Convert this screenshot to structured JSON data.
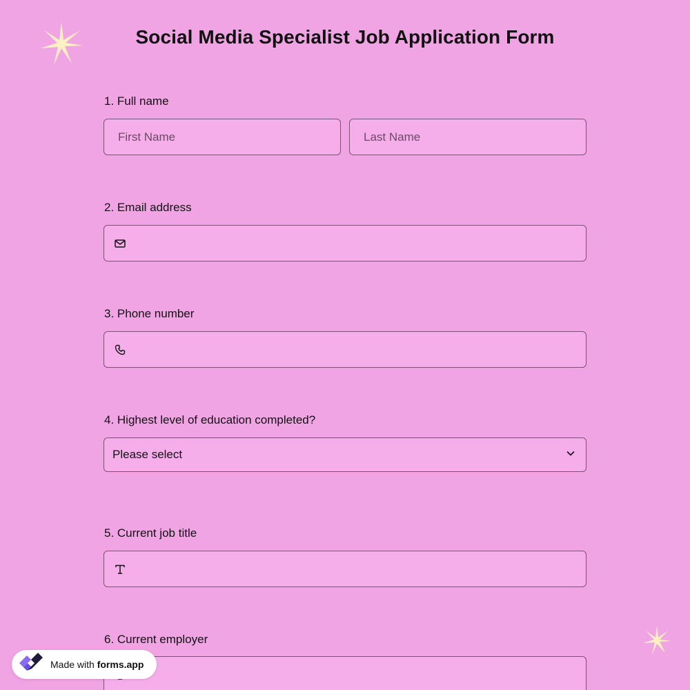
{
  "form": {
    "title": "Social Media Specialist Job Application Form"
  },
  "questions": {
    "full_name": {
      "label": "1.  Full name",
      "first_placeholder": "First Name",
      "last_placeholder": "Last Name"
    },
    "email": {
      "label": "2. Email address",
      "icon": "envelope-icon",
      "value": ""
    },
    "phone": {
      "label": "3. Phone number",
      "icon": "phone-icon",
      "value": ""
    },
    "education": {
      "label": "4. Highest level of education completed?",
      "selected": "Please select",
      "icon": "chevron-down-icon"
    },
    "job_title": {
      "label": "5. Current job title",
      "icon": "text-icon",
      "value": ""
    },
    "employer": {
      "label": "6. Current employer",
      "value": ""
    }
  },
  "badge": {
    "prefix": "Made with ",
    "brand": "forms.app",
    "icon": "forms-app-logo"
  },
  "colors": {
    "background": "#f0a4e4",
    "field_fill": "#f6aeeb",
    "field_border": "#7a5374",
    "sparkle": "#fdf1c4"
  }
}
